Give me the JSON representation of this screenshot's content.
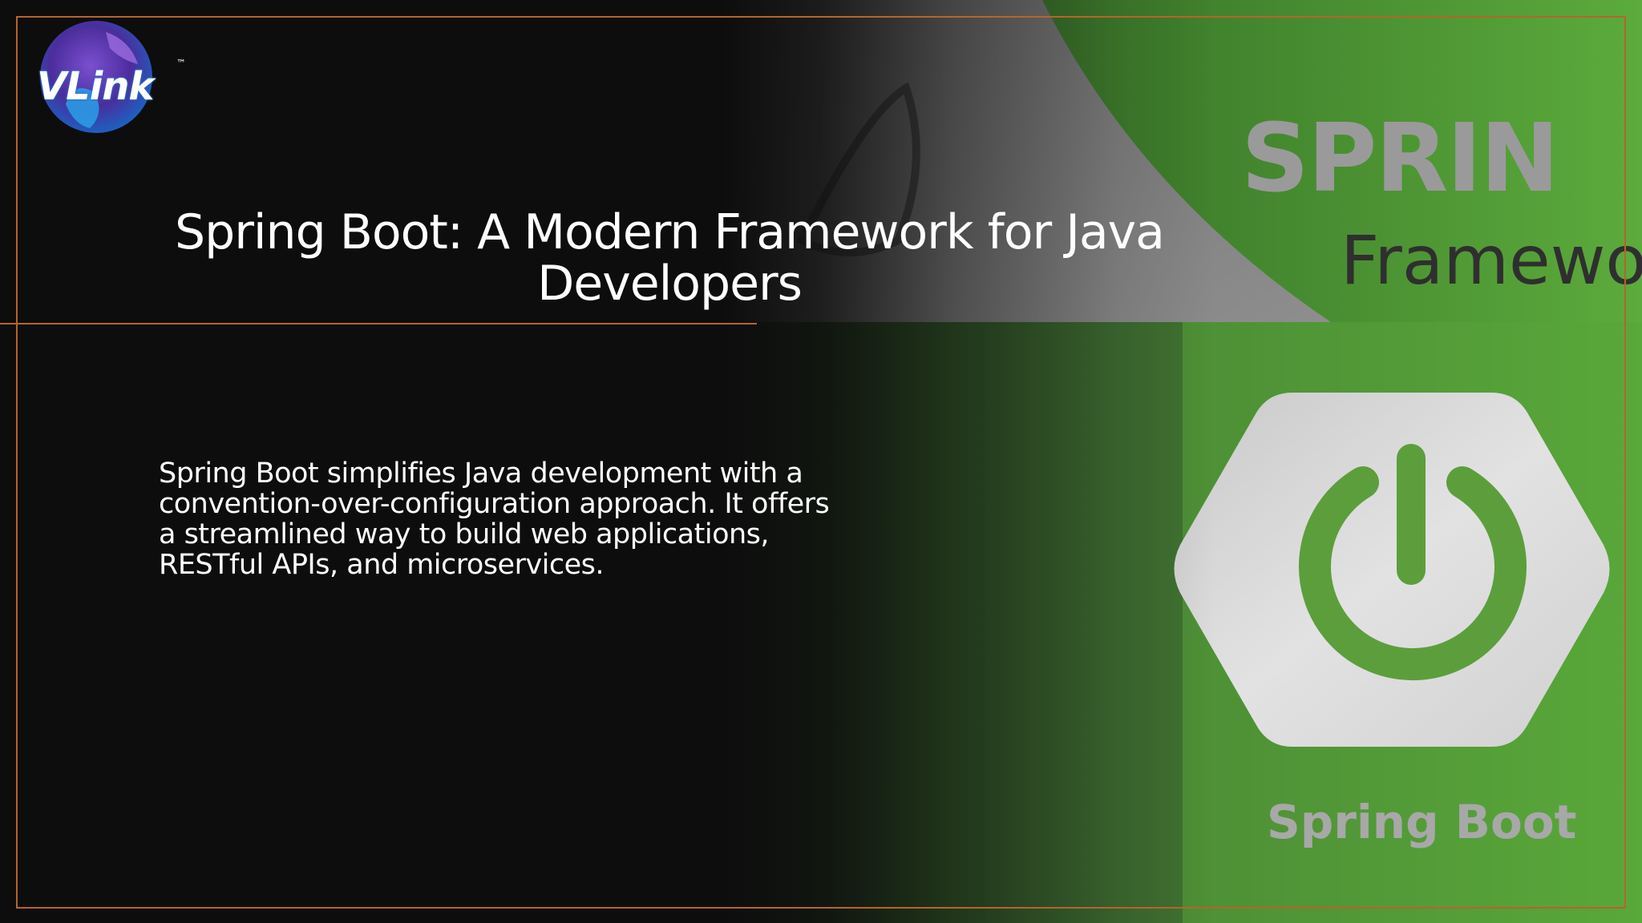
{
  "logo": {
    "text": "VLink",
    "trademark": "™"
  },
  "title": "Spring Boot: A Modern Framework for Java Developers",
  "body": "Spring Boot simplifies Java development with a convention-over-configuration approach. It offers a streamlined way to build web applications, RESTful APIs, and microservices.",
  "artwork": {
    "spring_text": "SPRIN",
    "framework_text": "Framewo",
    "boot_label": "Spring Boot"
  },
  "colors": {
    "background": "#0d0d0d",
    "accent_line": "#b5652a",
    "green": "#5aa338",
    "green_dark": "#2f5f25",
    "text": "#ffffff"
  }
}
